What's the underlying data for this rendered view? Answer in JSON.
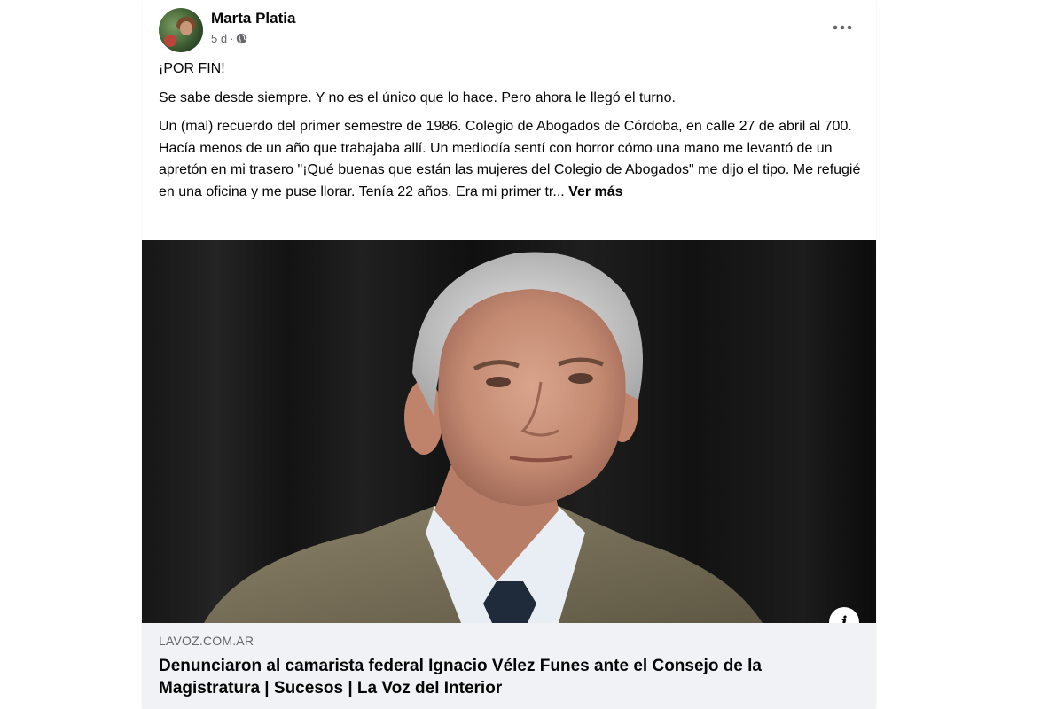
{
  "post": {
    "author": "Marta Platia",
    "time": "5 d",
    "separator": "·",
    "text": {
      "line1": "¡POR FIN!",
      "line2": "Se sabe desde siempre. Y no es el único que lo hace. Pero ahora le llegó el turno.",
      "line3": "Un (mal) recuerdo del primer semestre de 1986. Colegio de Abogados de Córdoba, en calle 27 de abril al 700. Hacía menos de un año que trabajaba allí. Un mediodía sentí con horror cómo una mano me levantó de un apretón en mi trasero \"¡Qué buenas que están las mujeres del Colegio de Abogados\" me dijo el tipo. Me refugié en una oficina y me puse llorar. Tenía 22 años. Era mi primer tr...",
      "see_more": "Ver más"
    },
    "icons": {
      "more": "more-options-icon",
      "privacy": "globe-icon",
      "info": "info-icon"
    },
    "info_label": "i"
  },
  "link": {
    "domain": "LAVOZ.COM.AR",
    "title": "Denunciaron al camarista federal Ignacio Vélez Funes ante el Consejo de la Magistratura | Sucesos | La Voz del Interior"
  },
  "colors": {
    "text": "#050505",
    "secondary": "#65676b",
    "link_bg": "#f0f2f5"
  }
}
